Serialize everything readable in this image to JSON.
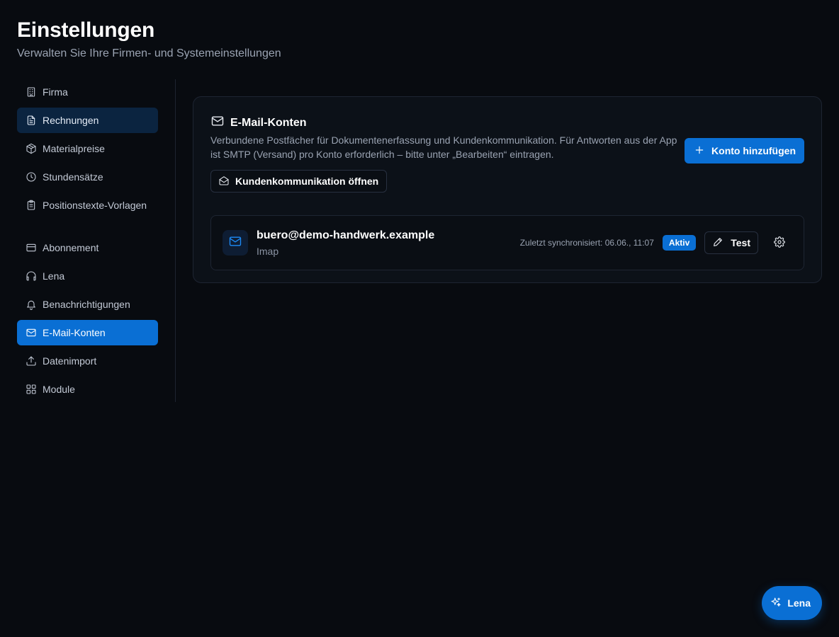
{
  "header": {
    "title": "Einstellungen",
    "subtitle": "Verwalten Sie Ihre Firmen- und Systemeinstellungen"
  },
  "sidebar": {
    "items": [
      {
        "label": "Firma",
        "icon": "building-icon"
      },
      {
        "label": "Rechnungen",
        "icon": "file-text-icon"
      },
      {
        "label": "Materialpreise",
        "icon": "package-icon"
      },
      {
        "label": "Stundensätze",
        "icon": "clock-icon"
      },
      {
        "label": "Positionstexte-Vorlagen",
        "icon": "clipboard-icon"
      },
      {
        "label": "Abonnement",
        "icon": "credit-card-icon"
      },
      {
        "label": "Lena",
        "icon": "headphones-icon"
      },
      {
        "label": "Benachrichtigungen",
        "icon": "bell-icon"
      },
      {
        "label": "E-Mail-Konten",
        "icon": "mail-icon"
      },
      {
        "label": "Datenimport",
        "icon": "upload-icon"
      },
      {
        "label": "Module",
        "icon": "grid-icon"
      }
    ]
  },
  "card": {
    "title": "E-Mail-Konten",
    "description": "Verbundene Postfächer für Dokumentenerfassung und Kundenkommunikation. Für Antworten aus der App ist SMTP (Versand) pro Konto erforderlich – bitte unter „Bearbeiten“ eintragen.",
    "add_button": "Konto hinzufügen",
    "open_comm_button": "Kundenkommunikation öffnen"
  },
  "account": {
    "email": "buero@demo-handwerk.example",
    "type": "Imap",
    "last_sync": "Zuletzt synchronisiert: 06.06., 11:07",
    "status": "Aktiv",
    "test_button": "Test"
  },
  "fab": {
    "label": "Lena"
  },
  "colors": {
    "background": "#080b10",
    "accent": "#0a6fd4",
    "card": "#0c1118"
  }
}
